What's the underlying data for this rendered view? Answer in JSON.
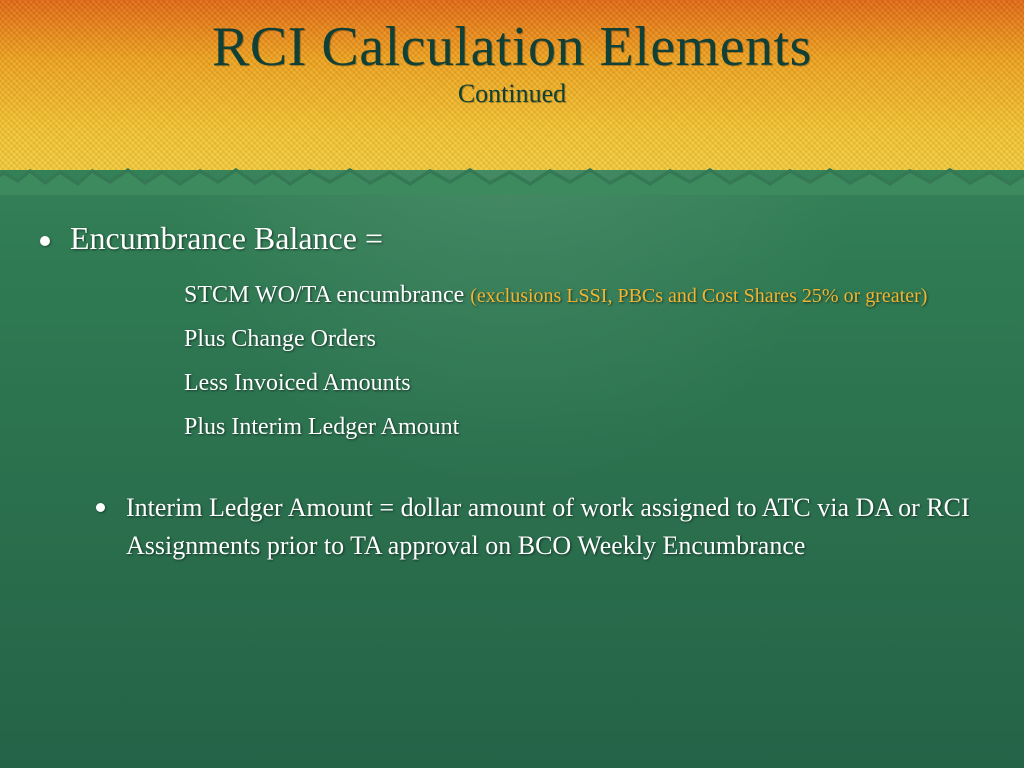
{
  "title": "RCI Calculation Elements",
  "subtitle": "Continued",
  "bullet1": "Encumbrance Balance =",
  "sub1a": "STCM WO/TA encumbrance ",
  "sub1a_excl": "(exclusions LSSI, PBCs and Cost Shares 25% or greater)",
  "sub2": "Plus  Change Orders",
  "sub3": "Less Invoiced Amounts",
  "sub4": "Plus Interim Ledger Amount",
  "bullet2": "Interim Ledger Amount = dollar amount of work assigned to ATC via DA or RCI Assignments prior to TA approval on BCO Weekly Encumbrance"
}
